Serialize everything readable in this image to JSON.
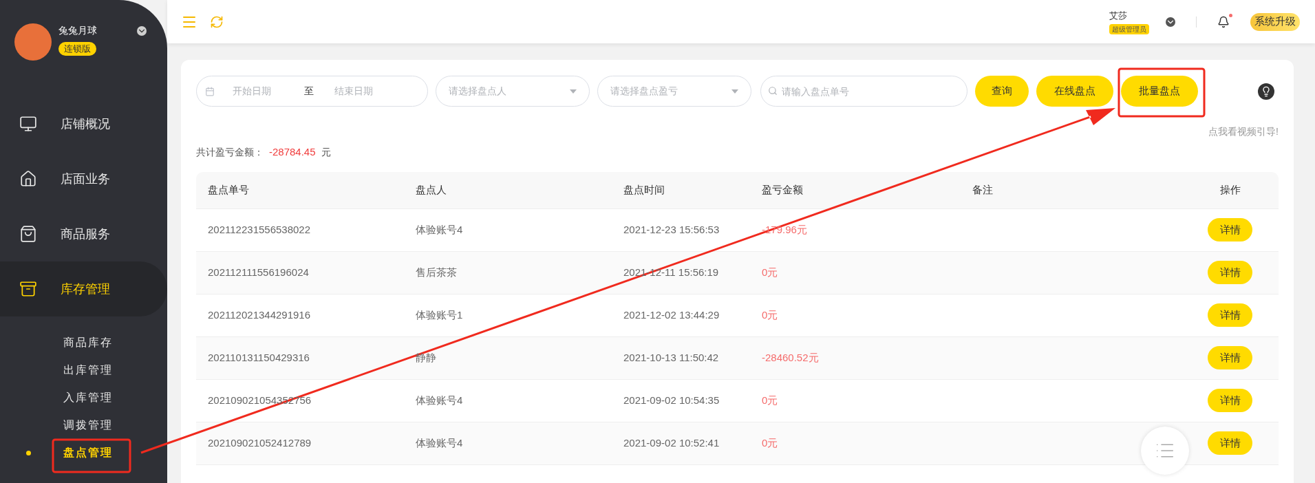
{
  "sidebar": {
    "user_name": "兔兔月球",
    "edition": "连锁版",
    "items": [
      {
        "label": "店铺概况",
        "selected": false
      },
      {
        "label": "店面业务",
        "selected": false
      },
      {
        "label": "商品服务",
        "selected": false
      },
      {
        "label": "库存管理",
        "selected": true,
        "children": [
          {
            "label": "商品库存",
            "selected": false
          },
          {
            "label": "出库管理",
            "selected": false
          },
          {
            "label": "入库管理",
            "selected": false
          },
          {
            "label": "调拨管理",
            "selected": false
          },
          {
            "label": "盘点管理",
            "selected": true
          }
        ]
      }
    ]
  },
  "topbar": {
    "user_name": "艾莎",
    "role": "超级管理员",
    "has_notification": true,
    "upgrade_button": "系统升级"
  },
  "filters": {
    "start_date_placeholder": "开始日期",
    "separator": "至",
    "end_date_placeholder": "结束日期",
    "counter_placeholder": "请选择盘点人",
    "result_placeholder": "请选择盘点盈亏",
    "search_placeholder": "请输入盘点单号"
  },
  "buttons": [
    "查询",
    "在线盘点",
    "批量盘点"
  ],
  "video_link": "点我看视频引导!",
  "summary": {
    "label": "共计盈亏金额：",
    "value": "-28784.45",
    "unit": "元"
  },
  "table": {
    "columns": [
      "盘点单号",
      "盘点人",
      "盘点时间",
      "盈亏金额",
      "备注",
      "操作"
    ],
    "rows": [
      {
        "number": "202112231556538022",
        "counter": "体验账号4",
        "time": "2021-12-23 15:56:53",
        "amount": "-179.96元",
        "action": "详情"
      },
      {
        "number": "202112111556196024",
        "counter": "售后茶茶",
        "time": "2021-12-11 15:56:19",
        "amount": "0元",
        "action": "详情"
      },
      {
        "number": "202112021344291916",
        "counter": "体验账号1",
        "time": "2021-12-02 13:44:29",
        "amount": "0元",
        "action": "详情"
      },
      {
        "number": "202110131150429316",
        "counter": "静静",
        "time": "2021-10-13 11:50:42",
        "amount": "-28460.52元",
        "action": "详情"
      },
      {
        "number": "202109021054352756",
        "counter": "体验账号4",
        "time": "2021-09-02 10:54:35",
        "amount": "0元",
        "action": "详情"
      },
      {
        "number": "202109021052412789",
        "counter": "体验账号4",
        "time": "2021-09-02 10:52:41",
        "amount": "0元",
        "action": "详情"
      }
    ]
  }
}
